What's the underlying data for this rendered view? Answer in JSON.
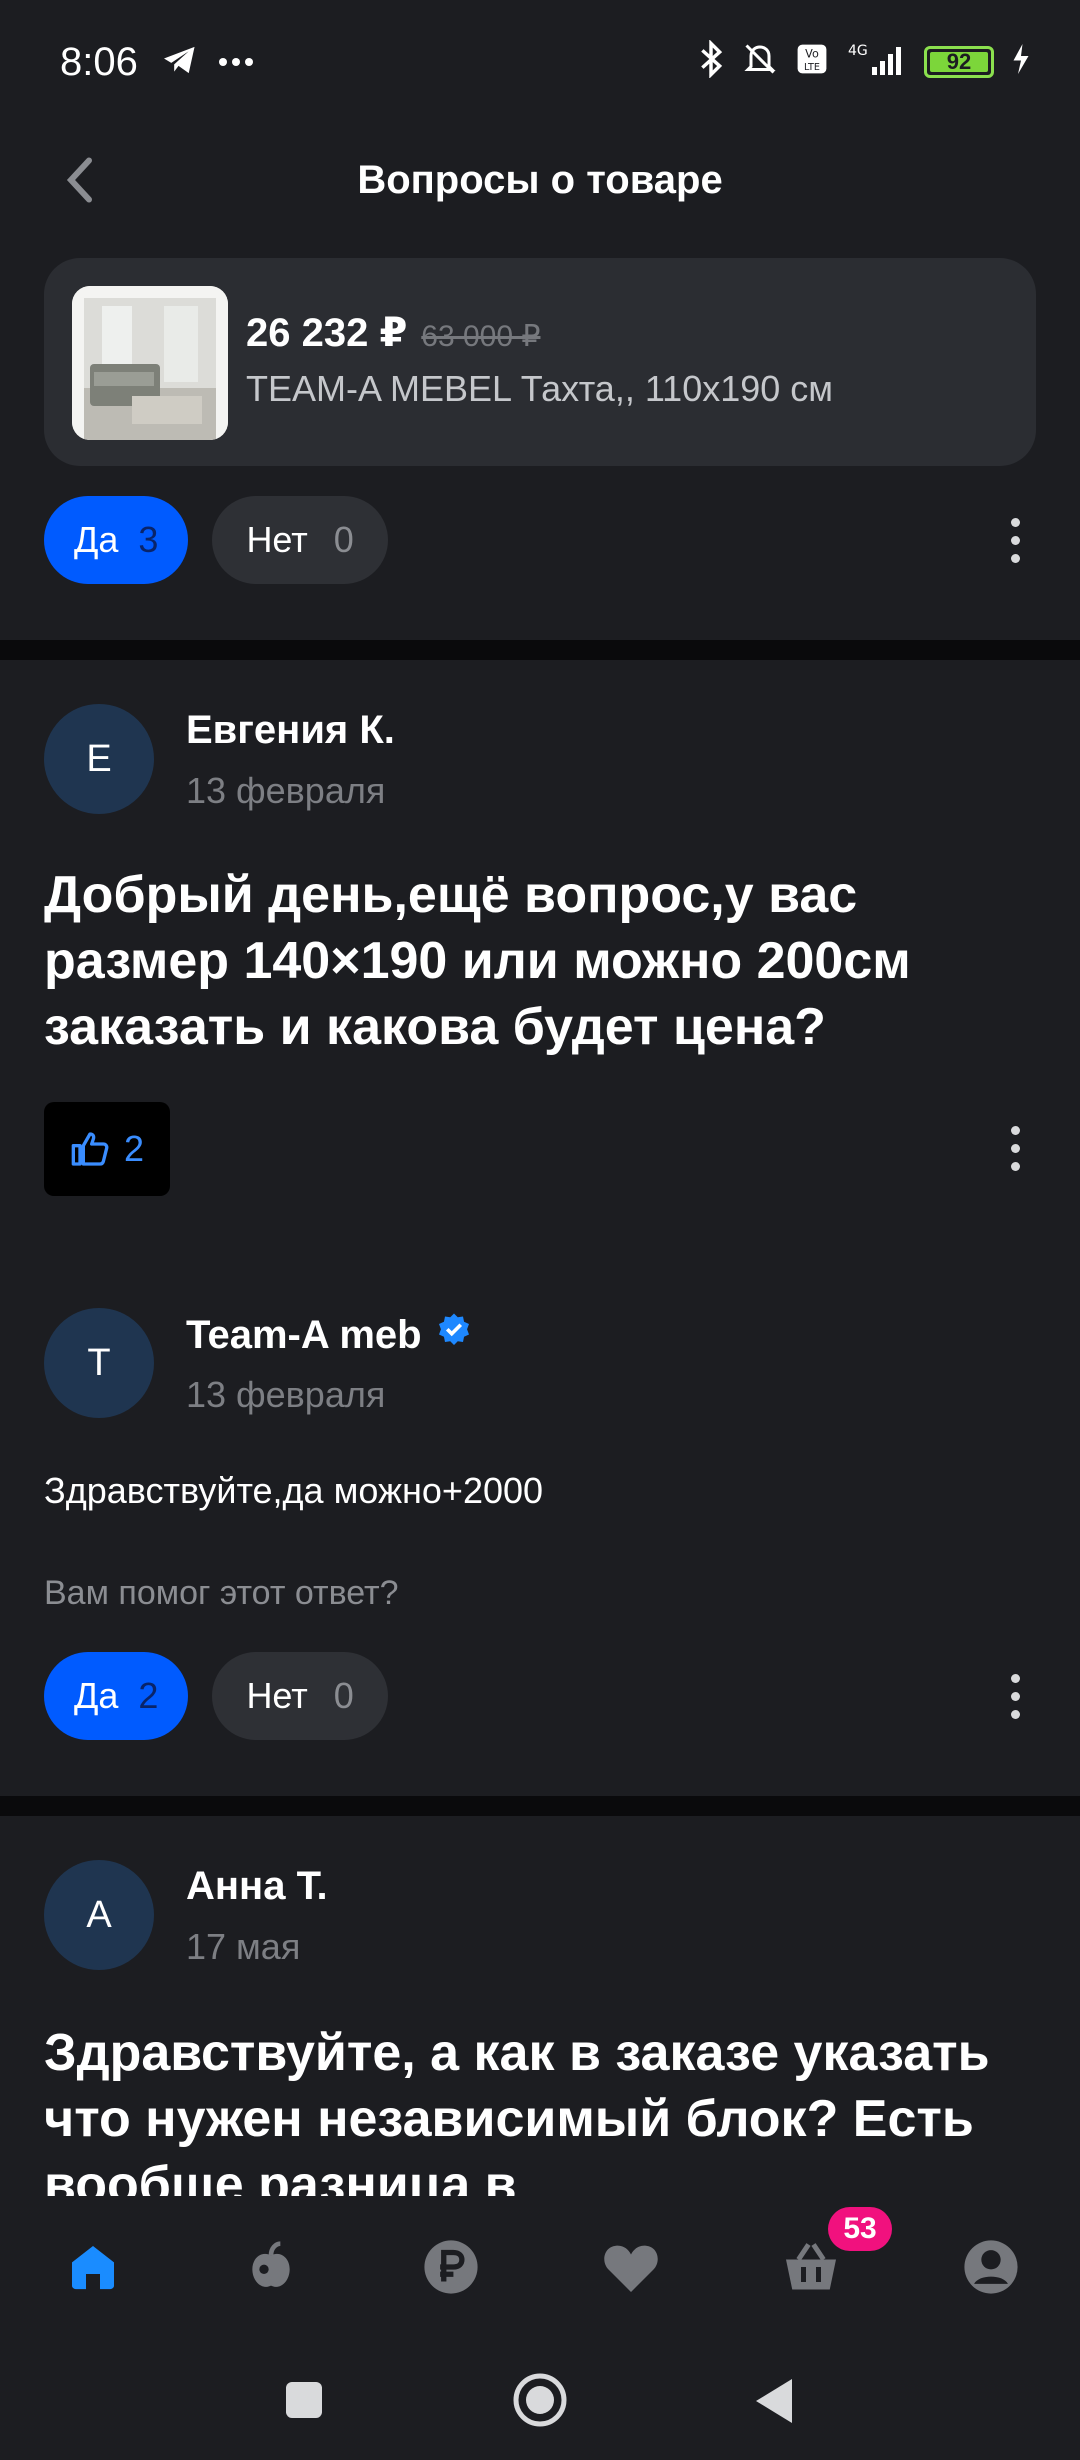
{
  "status_bar": {
    "time": "8:06",
    "battery": "92"
  },
  "header": {
    "title": "Вопросы о товаре"
  },
  "product": {
    "price": "26 232 ₽",
    "old_price": "63 000 ₽",
    "name": "TEAM-A MEBEL Тахта,, 110x190 см"
  },
  "top_votes": {
    "yes_label": "Да",
    "yes_count": "3",
    "no_label": "Нет",
    "no_count": "0"
  },
  "question1": {
    "avatar": "Е",
    "author": "Евгения К.",
    "date": "13 февраля",
    "text": "Добрый день,ещё вопрос,у вас размер 140×190 или можно 200см заказать и какова будет цена?",
    "likes": "2"
  },
  "answer1": {
    "avatar": "T",
    "author": "Team-A meb",
    "date": "13 февраля",
    "text": "Здравствуйте,да можно+2000",
    "helpful_prompt": "Вам помог этот ответ?",
    "yes_label": "Да",
    "yes_count": "2",
    "no_label": "Нет",
    "no_count": "0"
  },
  "question2": {
    "avatar": "А",
    "author": "Анна Т.",
    "date": "17 мая",
    "text": "Здравствуйте, а как в заказе указать что нужен независимый блок? Есть вообще разница в"
  },
  "bottom_nav": {
    "cart_badge": "53"
  },
  "colors": {
    "accent": "#005bff",
    "badge": "#f1117e",
    "background": "#1c1d21"
  }
}
